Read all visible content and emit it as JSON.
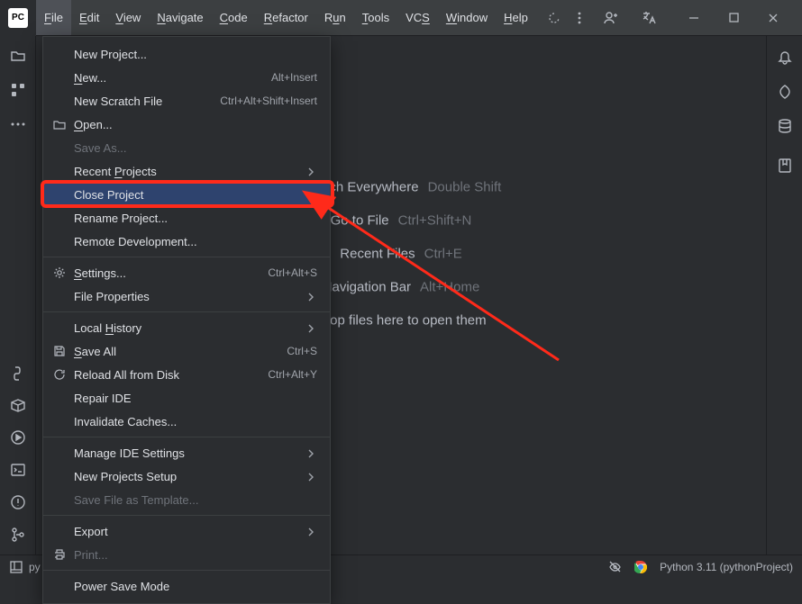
{
  "menubar": {
    "items": [
      {
        "label": "File",
        "mnemonic": 0,
        "active": true
      },
      {
        "label": "Edit",
        "mnemonic": 0
      },
      {
        "label": "View",
        "mnemonic": 0
      },
      {
        "label": "Navigate",
        "mnemonic": 0
      },
      {
        "label": "Code",
        "mnemonic": 0
      },
      {
        "label": "Refactor",
        "mnemonic": 0
      },
      {
        "label": "Run",
        "mnemonic": 1
      },
      {
        "label": "Tools",
        "mnemonic": 0
      },
      {
        "label": "VCS",
        "mnemonic": 2
      },
      {
        "label": "Window",
        "mnemonic": 0
      },
      {
        "label": "Help",
        "mnemonic": 0
      }
    ]
  },
  "app_icon": "PC",
  "file_menu": {
    "items": [
      {
        "label": "New Project...",
        "type": "item"
      },
      {
        "label": "New...",
        "mnemonic": 0,
        "shortcut": "Alt+Insert",
        "type": "item"
      },
      {
        "label": "New Scratch File",
        "shortcut": "Ctrl+Alt+Shift+Insert",
        "type": "item"
      },
      {
        "label": "Open...",
        "mnemonic": 0,
        "icon": "folder",
        "type": "item"
      },
      {
        "label": "Save As...",
        "disabled": true,
        "type": "item"
      },
      {
        "label": "Recent Projects",
        "mnemonic": 7,
        "submenu": true,
        "type": "item"
      },
      {
        "label": "Close Project",
        "highlight": true,
        "type": "item"
      },
      {
        "label": "Rename Project...",
        "type": "item"
      },
      {
        "label": "Remote Development...",
        "type": "item"
      },
      {
        "type": "separator"
      },
      {
        "label": "Settings...",
        "mnemonic": 0,
        "icon": "gear",
        "shortcut": "Ctrl+Alt+S",
        "type": "item"
      },
      {
        "label": "File Properties",
        "submenu": true,
        "type": "item"
      },
      {
        "type": "separator"
      },
      {
        "label": "Local History",
        "mnemonic": 6,
        "submenu": true,
        "type": "item"
      },
      {
        "label": "Save All",
        "mnemonic": 0,
        "icon": "save",
        "shortcut": "Ctrl+S",
        "type": "item"
      },
      {
        "label": "Reload All from Disk",
        "icon": "reload",
        "shortcut": "Ctrl+Alt+Y",
        "type": "item"
      },
      {
        "label": "Repair IDE",
        "type": "item"
      },
      {
        "label": "Invalidate Caches...",
        "type": "item"
      },
      {
        "type": "separator"
      },
      {
        "label": "Manage IDE Settings",
        "submenu": true,
        "type": "item"
      },
      {
        "label": "New Projects Setup",
        "submenu": true,
        "type": "item"
      },
      {
        "label": "Save File as Template...",
        "disabled": true,
        "type": "item"
      },
      {
        "type": "separator"
      },
      {
        "label": "Export",
        "submenu": true,
        "type": "item"
      },
      {
        "label": "Print...",
        "icon": "print",
        "disabled": true,
        "type": "item"
      },
      {
        "type": "separator"
      },
      {
        "label": "Power Save Mode",
        "type": "item"
      }
    ]
  },
  "welcome": {
    "hints": [
      {
        "label": "Search Everywhere",
        "shortcut": "Double Shift"
      },
      {
        "label": "Go to File",
        "shortcut": "Ctrl+Shift+N"
      },
      {
        "label": "Recent Files",
        "shortcut": "Ctrl+E"
      },
      {
        "label": "Navigation Bar",
        "shortcut": "Alt+Home"
      },
      {
        "label": "Drop files here to open them",
        "shortcut": ""
      }
    ]
  },
  "statusbar": {
    "project_filter": "py",
    "interpreter": "Python 3.11 (pythonProject)"
  }
}
